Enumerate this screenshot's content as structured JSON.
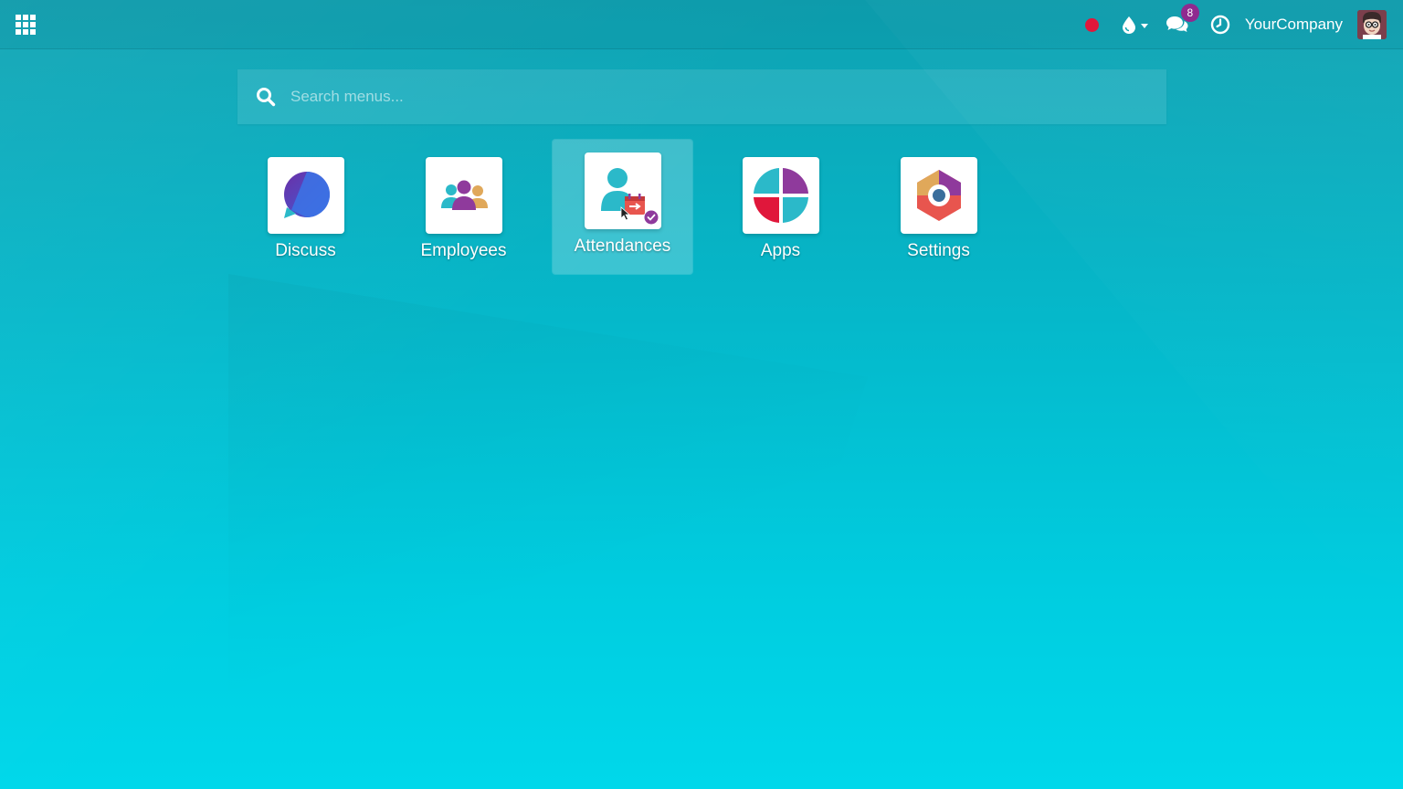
{
  "navbar": {
    "apps_menu_icon": "grid-icon",
    "recording_indicator_color": "#e0173b",
    "debug_icon": "droplet-icon",
    "messages_icon": "chat-icon",
    "messages_badge": "8",
    "activities_icon": "clock-icon",
    "company_name": "YourCompany",
    "user_avatar": "avatar-icon"
  },
  "search": {
    "icon": "search-icon",
    "placeholder": "Search menus..."
  },
  "apps": [
    {
      "label": "Discuss",
      "icon": "discuss-icon"
    },
    {
      "label": "Employees",
      "icon": "employees-icon"
    },
    {
      "label": "Attendances",
      "icon": "attendances-icon",
      "active": true
    },
    {
      "label": "Apps",
      "icon": "apps-icon"
    },
    {
      "label": "Settings",
      "icon": "settings-icon"
    }
  ],
  "colors": {
    "background_top": "#0fa2b2",
    "background_bottom": "#00d8ea",
    "badge": "#8f2a8f"
  }
}
